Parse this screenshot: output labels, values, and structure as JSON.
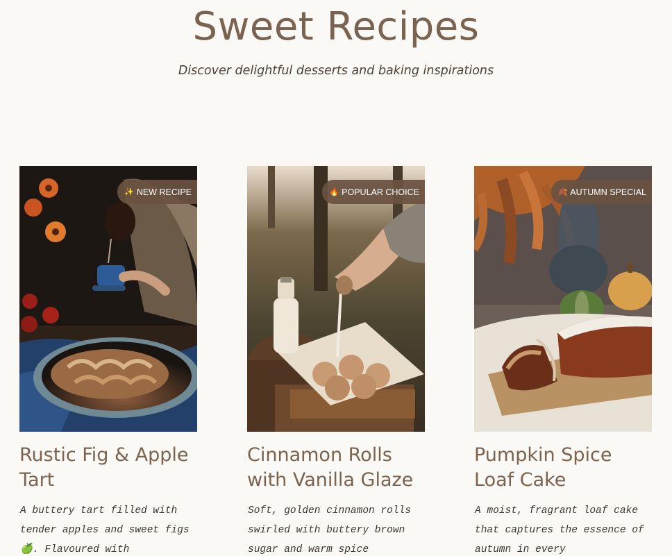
{
  "header": {
    "title": "Sweet Recipes",
    "subtitle": "Discover delightful desserts and baking inspirations"
  },
  "recipes": [
    {
      "badge_icon": "sparkles-icon",
      "badge_glyph": "✨",
      "badge": "NEW RECIPE",
      "title": "Rustic Fig & Apple Tart",
      "description": "A buttery tart filled with tender apples and sweet figs 🍏. Flavoured with"
    },
    {
      "badge_icon": "fire-icon",
      "badge_glyph": "🔥",
      "badge": "POPULAR CHOICE",
      "title": "Cinnamon Rolls with Vanilla Glaze",
      "description": "Soft, golden cinnamon rolls swirled with buttery brown sugar and warm spice"
    },
    {
      "badge_icon": "maple-leaf-icon",
      "badge_glyph": "🍂",
      "badge": "AUTUMN SPECIAL",
      "title": "Pumpkin Spice Loaf Cake",
      "description": "A moist, fragrant loaf cake that captures the essence of autumn in every"
    }
  ],
  "colors": {
    "background": "#fbf9f6",
    "heading": "#7a6350",
    "badge": "#6b5241",
    "body_text": "#3f3530"
  }
}
